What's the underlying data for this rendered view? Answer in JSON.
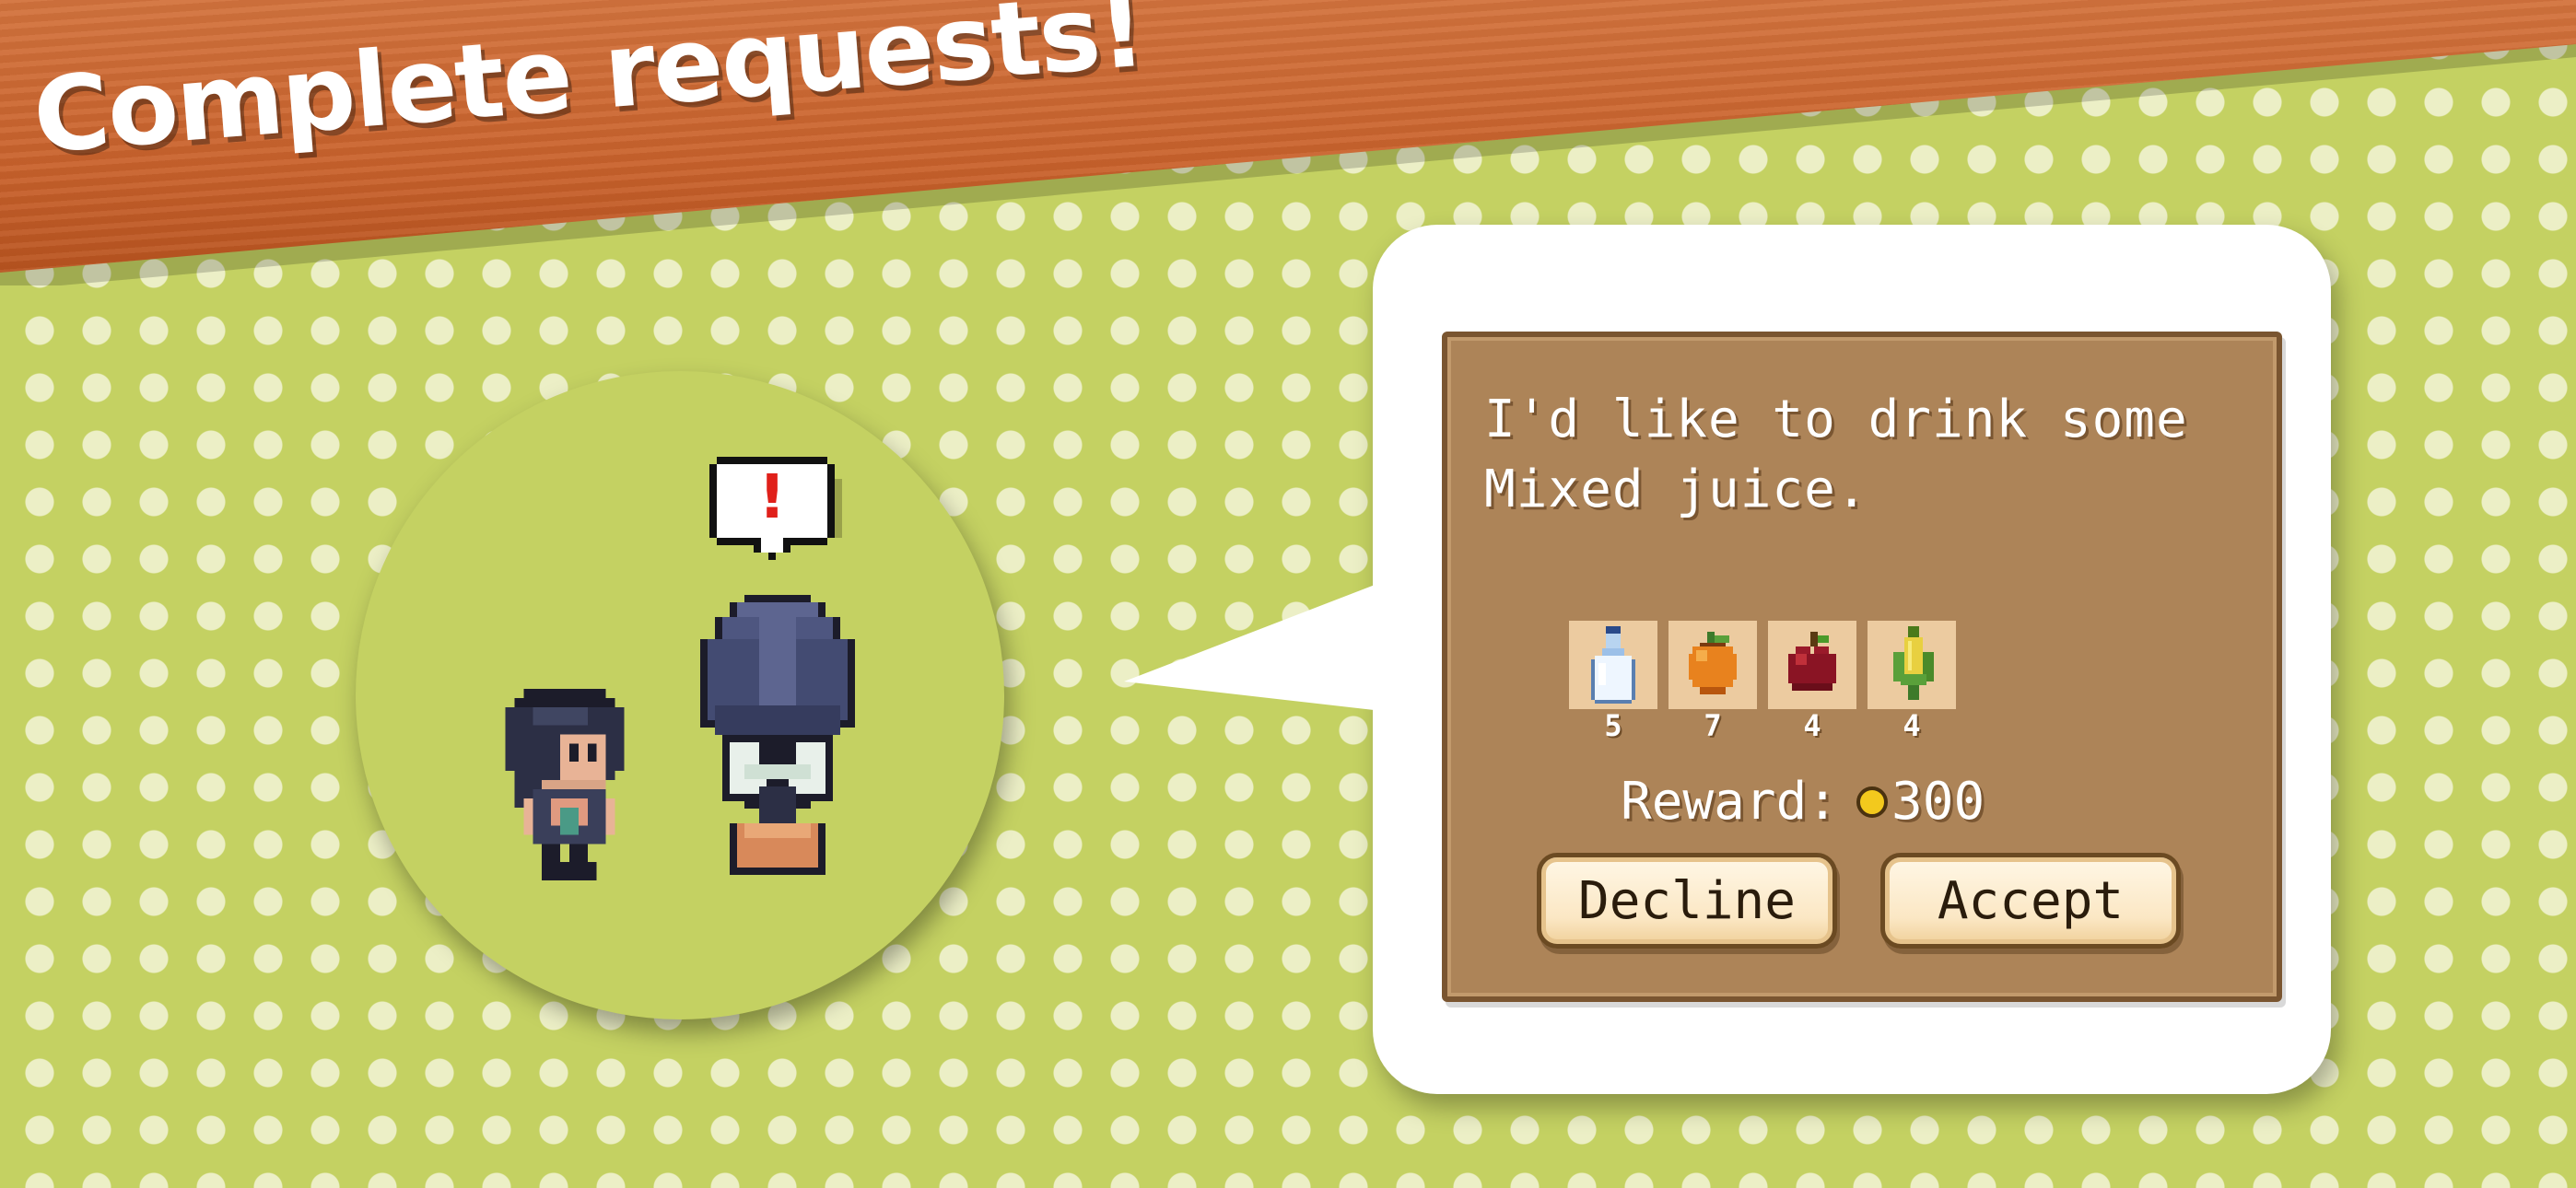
{
  "banner": {
    "title": "Complete requests!"
  },
  "scene": {
    "npc_alert_glyph": "!"
  },
  "request": {
    "message": "I'd like to drink some Mixed juice.",
    "ingredients": [
      {
        "name": "milk",
        "icon": "milk-bottle-icon",
        "count": "5"
      },
      {
        "name": "orange",
        "icon": "orange-icon",
        "count": "7"
      },
      {
        "name": "apple",
        "icon": "apple-icon",
        "count": "4"
      },
      {
        "name": "corn",
        "icon": "corn-icon",
        "count": "4"
      }
    ],
    "reward_label": "Reward:",
    "reward_amount": "300",
    "decline_label": "Decline",
    "accept_label": "Accept"
  },
  "colors": {
    "background": "#c4d162",
    "banner": "#c9622c",
    "dialog": "#ad8458",
    "button": "#fbe7c4",
    "coin": "#f3c91d"
  }
}
